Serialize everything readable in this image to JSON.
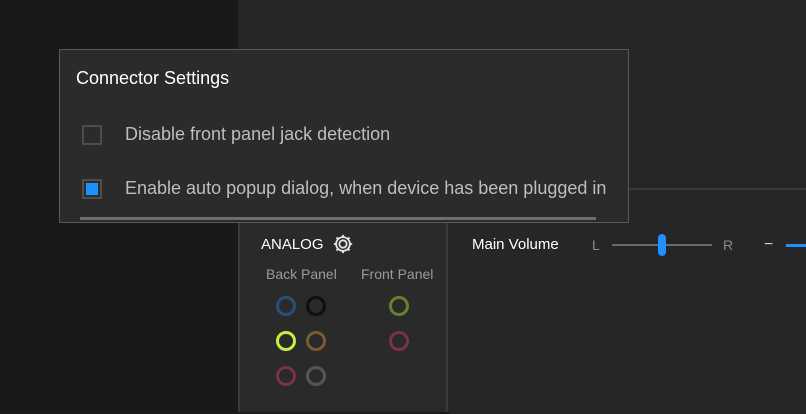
{
  "analog": {
    "title": "ANALOG",
    "back_panel_label": "Back Panel",
    "front_panel_label": "Front Panel",
    "back_jacks": [
      {
        "color": "#2a4f7a"
      },
      {
        "color": "#0f0f0f"
      },
      {
        "color": "#c6f03a"
      },
      {
        "color": "#7a5a32"
      },
      {
        "color": "#7a3248"
      },
      {
        "color": "#555555"
      }
    ],
    "front_jacks": [
      {
        "color": "#66802e"
      },
      {
        "color": "#7a3248"
      }
    ]
  },
  "main_volume": {
    "label": "Main Volume",
    "left": "L",
    "right": "R",
    "balance_value": 0.5,
    "minus": "−"
  },
  "dialog": {
    "title": "Connector Settings",
    "options": [
      {
        "label": "Disable front panel jack detection",
        "checked": false
      },
      {
        "label": "Enable auto popup dialog, when device has been plugged in",
        "checked": true
      }
    ]
  },
  "colors": {
    "accent": "#1e90ff"
  }
}
